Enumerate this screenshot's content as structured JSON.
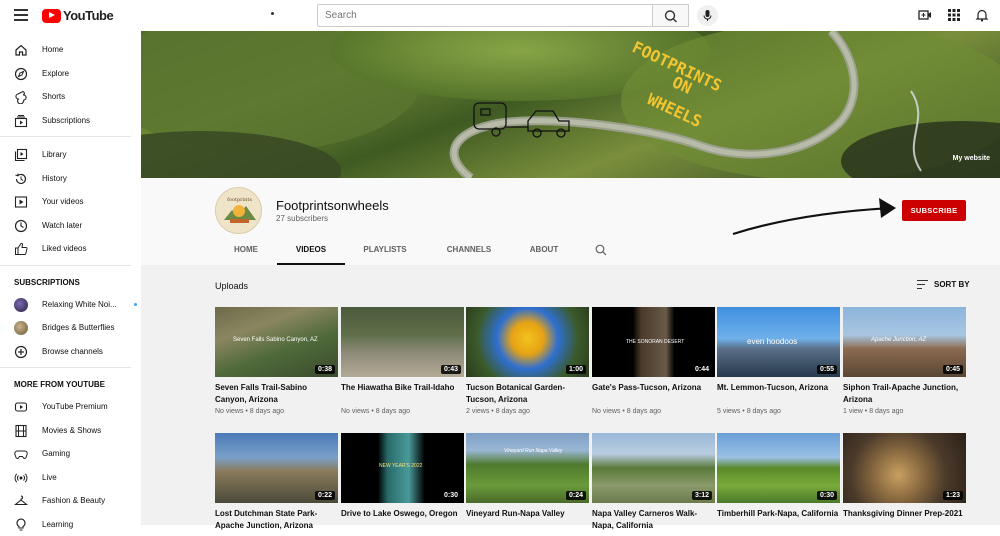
{
  "app": {
    "logo_text": "YouTube"
  },
  "search": {
    "placeholder": "Search"
  },
  "sidebar": {
    "main": [
      {
        "label": "Home",
        "icon": "home-icon"
      },
      {
        "label": "Explore",
        "icon": "compass-icon"
      },
      {
        "label": "Shorts",
        "icon": "shorts-icon"
      },
      {
        "label": "Subscriptions",
        "icon": "subscriptions-icon"
      }
    ],
    "library": [
      {
        "label": "Library",
        "icon": "library-icon"
      },
      {
        "label": "History",
        "icon": "history-icon"
      },
      {
        "label": "Your videos",
        "icon": "your-videos-icon"
      },
      {
        "label": "Watch later",
        "icon": "clock-icon"
      },
      {
        "label": "Liked videos",
        "icon": "thumbs-up-icon"
      }
    ],
    "subscriptions_heading": "SUBSCRIPTIONS",
    "subscriptions": [
      {
        "label": "Relaxing White Noi...",
        "live": true
      },
      {
        "label": "Bridges & Butterflies",
        "live": false
      },
      {
        "label": "Browse channels",
        "icon": "plus-circle-icon"
      }
    ],
    "more_heading": "MORE FROM YOUTUBE",
    "more": [
      {
        "label": "YouTube Premium",
        "icon": "youtube-premium-icon"
      },
      {
        "label": "Movies & Shows",
        "icon": "film-icon"
      },
      {
        "label": "Gaming",
        "icon": "gamepad-icon"
      },
      {
        "label": "Live",
        "icon": "live-icon"
      },
      {
        "label": "Fashion & Beauty",
        "icon": "hanger-icon"
      },
      {
        "label": "Learning",
        "icon": "bulb-icon"
      }
    ]
  },
  "banner": {
    "overlay_text": "FOOTPRINTS ON WHEELS",
    "link_label": "My website"
  },
  "channel": {
    "name": "Footprintsonwheels",
    "subscribers": "27 subscribers",
    "subscribe_label": "SUBSCRIBE",
    "tabs": [
      "HOME",
      "VIDEOS",
      "PLAYLISTS",
      "CHANNELS",
      "ABOUT"
    ],
    "active_tab": "VIDEOS"
  },
  "uploads": {
    "heading": "Uploads",
    "sort_label": "SORT BY",
    "videos": [
      {
        "title": "Seven Falls Trail-Sabino Canyon, Arizona",
        "views": "No views",
        "age": "8 days ago",
        "duration": "0:38",
        "thumb_text": "Seven Falls Sabino Canyon, AZ"
      },
      {
        "title": "The Hiawatha Bike Trail-Idaho",
        "views": "No views",
        "age": "8 days ago",
        "duration": "0:43",
        "thumb_text": ""
      },
      {
        "title": "Tucson Botanical Garden-Tucson, Arizona",
        "views": "2 views",
        "age": "8 days ago",
        "duration": "1:00",
        "thumb_text": ""
      },
      {
        "title": "Gate's Pass-Tucson, Arizona",
        "views": "No views",
        "age": "8 days ago",
        "duration": "0:44",
        "thumb_text": "THE SONORAN DESERT"
      },
      {
        "title": "Mt. Lemmon-Tucson, Arizona",
        "views": "5 views",
        "age": "8 days ago",
        "duration": "0:55",
        "thumb_text": "even hoodoos"
      },
      {
        "title": "Siphon Trail-Apache Junction, Arizona",
        "views": "1 view",
        "age": "8 days ago",
        "duration": "0:45",
        "thumb_text": "Apache Junction, AZ"
      },
      {
        "title": "Lost Dutchman State Park-Apache Junction, Arizona",
        "views": "",
        "age": "",
        "duration": "0:22",
        "thumb_text": ""
      },
      {
        "title": "Drive to Lake Oswego, Oregon",
        "views": "",
        "age": "",
        "duration": "0:30",
        "thumb_text": "NEW YEAR'S 2022"
      },
      {
        "title": "Vineyard Run-Napa Valley",
        "views": "",
        "age": "",
        "duration": "0:24",
        "thumb_text": "Vineyard Run Napa Valley"
      },
      {
        "title": "Napa Valley Carneros Walk-Napa, California",
        "views": "",
        "age": "",
        "duration": "3:12",
        "thumb_text": ""
      },
      {
        "title": "Timberhill Park-Napa, California",
        "views": "",
        "age": "",
        "duration": "0:30",
        "thumb_text": ""
      },
      {
        "title": "Thanksgiving Dinner Prep-2021",
        "views": "",
        "age": "",
        "duration": "1:23",
        "thumb_text": ""
      }
    ]
  },
  "colors": {
    "brand_red": "#ff0000",
    "subscribe_red": "#cc0000",
    "banner_text_yellow": "#f2c531"
  }
}
